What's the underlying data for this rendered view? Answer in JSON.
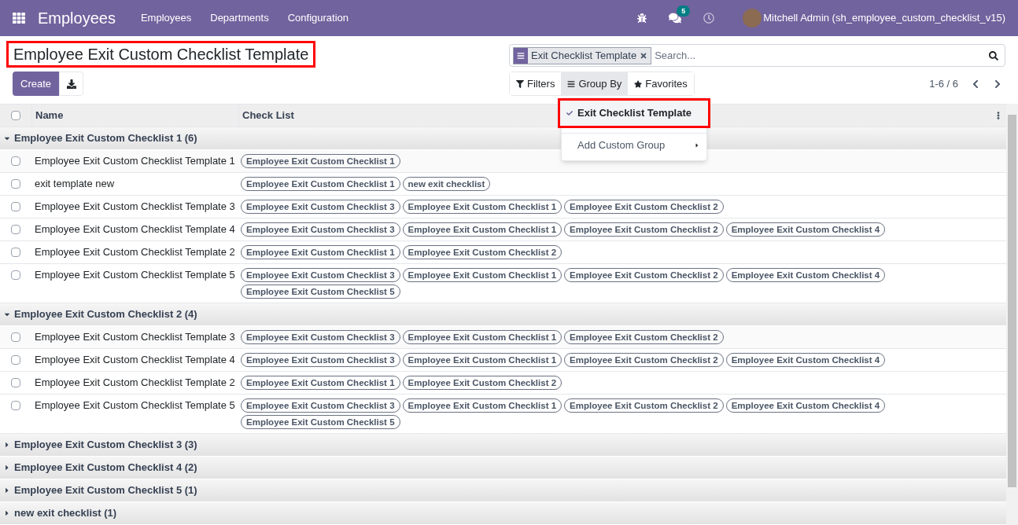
{
  "navbar": {
    "app_title": "Employees",
    "menu": [
      "Employees",
      "Departments",
      "Configuration"
    ],
    "chat_badge": "5",
    "user": "Mitchell Admin (sh_employee_custom_checklist_v15)"
  },
  "page_title": "Employee Exit Custom Checklist Template",
  "create_button": "Create",
  "search": {
    "facet": "Exit Checklist Template",
    "placeholder": "Search..."
  },
  "search_options": [
    {
      "kind": "filter",
      "label": "Filters",
      "selected": false
    },
    {
      "kind": "groupby",
      "label": "Group By",
      "selected": true
    },
    {
      "kind": "favorite",
      "label": "Favorites",
      "selected": false
    }
  ],
  "pager": "1-6 / 6",
  "groupby_menu": [
    {
      "kind": "option",
      "label": "Exit Checklist Template",
      "checked": true
    },
    {
      "kind": "submenu",
      "label": "Add Custom Group"
    }
  ],
  "table": {
    "columns": [
      "Name",
      "Check List"
    ],
    "all_checked": false,
    "groups": [
      {
        "label": "Employee Exit Custom Checklist 1 (6)",
        "expanded": true,
        "rows": [
          {
            "name": "Employee Exit Custom Checklist Template 1",
            "checked": false,
            "tags": [
              "Employee Exit Custom Checklist 1"
            ]
          },
          {
            "name": "exit template new",
            "checked": false,
            "tags": [
              "Employee Exit Custom Checklist 1",
              "new exit checklist"
            ]
          },
          {
            "name": "Employee Exit Custom Checklist Template 3",
            "checked": false,
            "tags": [
              "Employee Exit Custom Checklist 3",
              "Employee Exit Custom Checklist 1",
              "Employee Exit Custom Checklist 2"
            ]
          },
          {
            "name": "Employee Exit Custom Checklist Template 4",
            "checked": false,
            "tags": [
              "Employee Exit Custom Checklist 3",
              "Employee Exit Custom Checklist 1",
              "Employee Exit Custom Checklist 2",
              "Employee Exit Custom Checklist 4"
            ]
          },
          {
            "name": "Employee Exit Custom Checklist Template 2",
            "checked": false,
            "tags": [
              "Employee Exit Custom Checklist 1",
              "Employee Exit Custom Checklist 2"
            ]
          },
          {
            "name": "Employee Exit Custom Checklist Template 5",
            "checked": false,
            "tags": [
              "Employee Exit Custom Checklist 3",
              "Employee Exit Custom Checklist 1",
              "Employee Exit Custom Checklist 2",
              "Employee Exit Custom Checklist 4",
              "Employee Exit Custom Checklist 5"
            ]
          }
        ]
      },
      {
        "label": "Employee Exit Custom Checklist 2 (4)",
        "expanded": true,
        "rows": [
          {
            "name": "Employee Exit Custom Checklist Template 3",
            "checked": false,
            "tags": [
              "Employee Exit Custom Checklist 3",
              "Employee Exit Custom Checklist 1",
              "Employee Exit Custom Checklist 2"
            ]
          },
          {
            "name": "Employee Exit Custom Checklist Template 4",
            "checked": false,
            "tags": [
              "Employee Exit Custom Checklist 3",
              "Employee Exit Custom Checklist 1",
              "Employee Exit Custom Checklist 2",
              "Employee Exit Custom Checklist 4"
            ]
          },
          {
            "name": "Employee Exit Custom Checklist Template 2",
            "checked": false,
            "tags": [
              "Employee Exit Custom Checklist 1",
              "Employee Exit Custom Checklist 2"
            ]
          },
          {
            "name": "Employee Exit Custom Checklist Template 5",
            "checked": false,
            "tags": [
              "Employee Exit Custom Checklist 3",
              "Employee Exit Custom Checklist 1",
              "Employee Exit Custom Checklist 2",
              "Employee Exit Custom Checklist 4",
              "Employee Exit Custom Checklist 5"
            ]
          }
        ]
      },
      {
        "label": "Employee Exit Custom Checklist 3 (3)",
        "expanded": false
      },
      {
        "label": "Employee Exit Custom Checklist 4 (2)",
        "expanded": false
      },
      {
        "label": "Employee Exit Custom Checklist 5 (1)",
        "expanded": false
      },
      {
        "label": "new exit checklist (1)",
        "expanded": false
      }
    ]
  }
}
